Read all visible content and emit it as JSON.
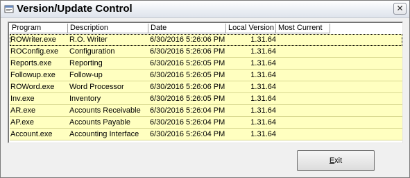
{
  "window": {
    "title": "Version/Update Control",
    "close_glyph": "✕"
  },
  "table": {
    "columns": [
      "Program",
      "Description",
      "Date",
      "Local Version",
      "Most Current"
    ],
    "rows": [
      {
        "program": "ROWriter.exe",
        "description": "R.O. Writer",
        "date": "6/30/2016 5:26:06 PM",
        "local_version": "1.31.64",
        "most_current": ""
      },
      {
        "program": "ROConfig.exe",
        "description": "Configuration",
        "date": "6/30/2016 5:26:06 PM",
        "local_version": "1.31.64",
        "most_current": ""
      },
      {
        "program": "Reports.exe",
        "description": "Reporting",
        "date": "6/30/2016 5:26:05 PM",
        "local_version": "1.31.64",
        "most_current": ""
      },
      {
        "program": "Followup.exe",
        "description": "Follow-up",
        "date": "6/30/2016 5:26:05 PM",
        "local_version": "1.31.64",
        "most_current": ""
      },
      {
        "program": "ROWord.exe",
        "description": "Word Processor",
        "date": "6/30/2016 5:26:06 PM",
        "local_version": "1.31.64",
        "most_current": ""
      },
      {
        "program": "Inv.exe",
        "description": "Inventory",
        "date": "6/30/2016 5:26:05 PM",
        "local_version": "1.31.64",
        "most_current": ""
      },
      {
        "program": "AR.exe",
        "description": "Accounts Receivable",
        "date": "6/30/2016 5:26:04 PM",
        "local_version": "1.31.64",
        "most_current": ""
      },
      {
        "program": "AP.exe",
        "description": "Accounts Payable",
        "date": "6/30/2016 5:26:04 PM",
        "local_version": "1.31.64",
        "most_current": ""
      },
      {
        "program": "Account.exe",
        "description": "Accounting Interface",
        "date": "6/30/2016 5:26:04 PM",
        "local_version": "1.31.64",
        "most_current": ""
      }
    ]
  },
  "buttons": {
    "exit_mnemonic": "E",
    "exit_rest": "xit"
  },
  "icons": {
    "app": "app-window-icon",
    "close": "close-icon"
  },
  "colors": {
    "row_background": "#ffffc0",
    "title_bar": "#e9edf3"
  }
}
